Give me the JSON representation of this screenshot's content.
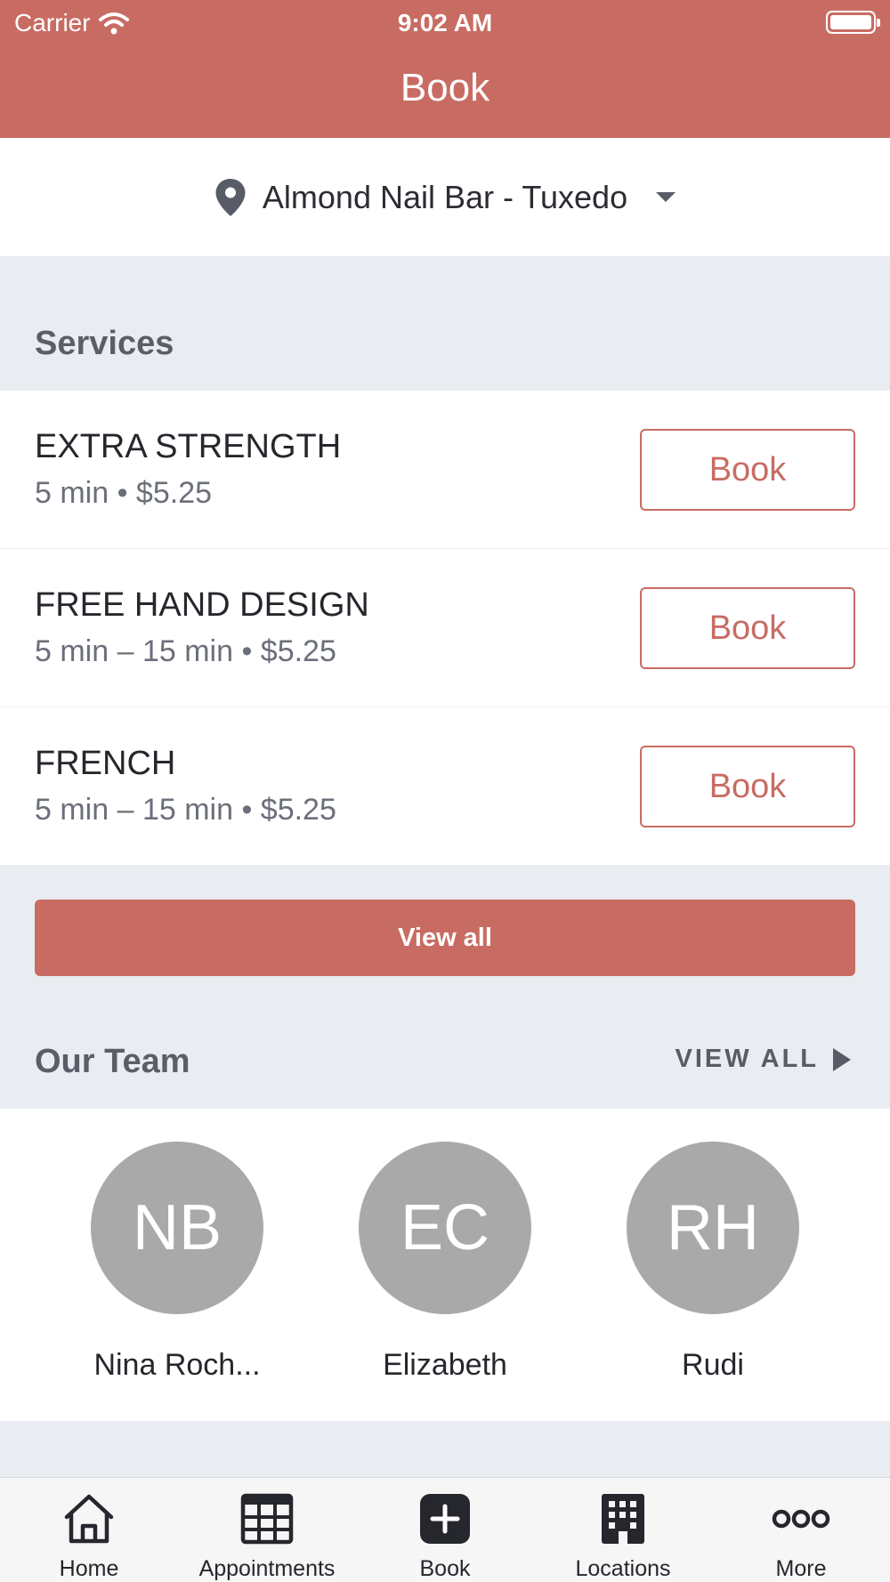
{
  "status_bar": {
    "carrier": "Carrier",
    "time": "9:02 AM"
  },
  "header": {
    "title": "Book"
  },
  "location": {
    "name": "Almond Nail Bar - Tuxedo",
    "icon": "map-pin-icon"
  },
  "services": {
    "title": "Services",
    "items": [
      {
        "name": "EXTRA STRENGTH",
        "meta": "5 min • $5.25",
        "button": "Book"
      },
      {
        "name": "FREE HAND DESIGN",
        "meta": "5 min – 15 min • $5.25",
        "button": "Book"
      },
      {
        "name": "FRENCH",
        "meta": "5 min – 15 min • $5.25",
        "button": "Book"
      }
    ],
    "view_all_label": "View all"
  },
  "team": {
    "title": "Our Team",
    "view_all_label": "VIEW ALL",
    "members": [
      {
        "initials": "NB",
        "name": "Nina Roch..."
      },
      {
        "initials": "EC",
        "name": "Elizabeth"
      },
      {
        "initials": "RH",
        "name": "Rudi"
      }
    ]
  },
  "tabbar": {
    "items": [
      {
        "label": "Home",
        "icon": "home-icon"
      },
      {
        "label": "Appointments",
        "icon": "calendar-grid-icon"
      },
      {
        "label": "Book",
        "icon": "plus-icon",
        "active": true
      },
      {
        "label": "Locations",
        "icon": "building-icon"
      },
      {
        "label": "More",
        "icon": "more-dots-icon"
      }
    ]
  },
  "colors": {
    "accent": "#c86c63",
    "background": "#e9ecf1",
    "avatar": "#a9a9a9"
  }
}
